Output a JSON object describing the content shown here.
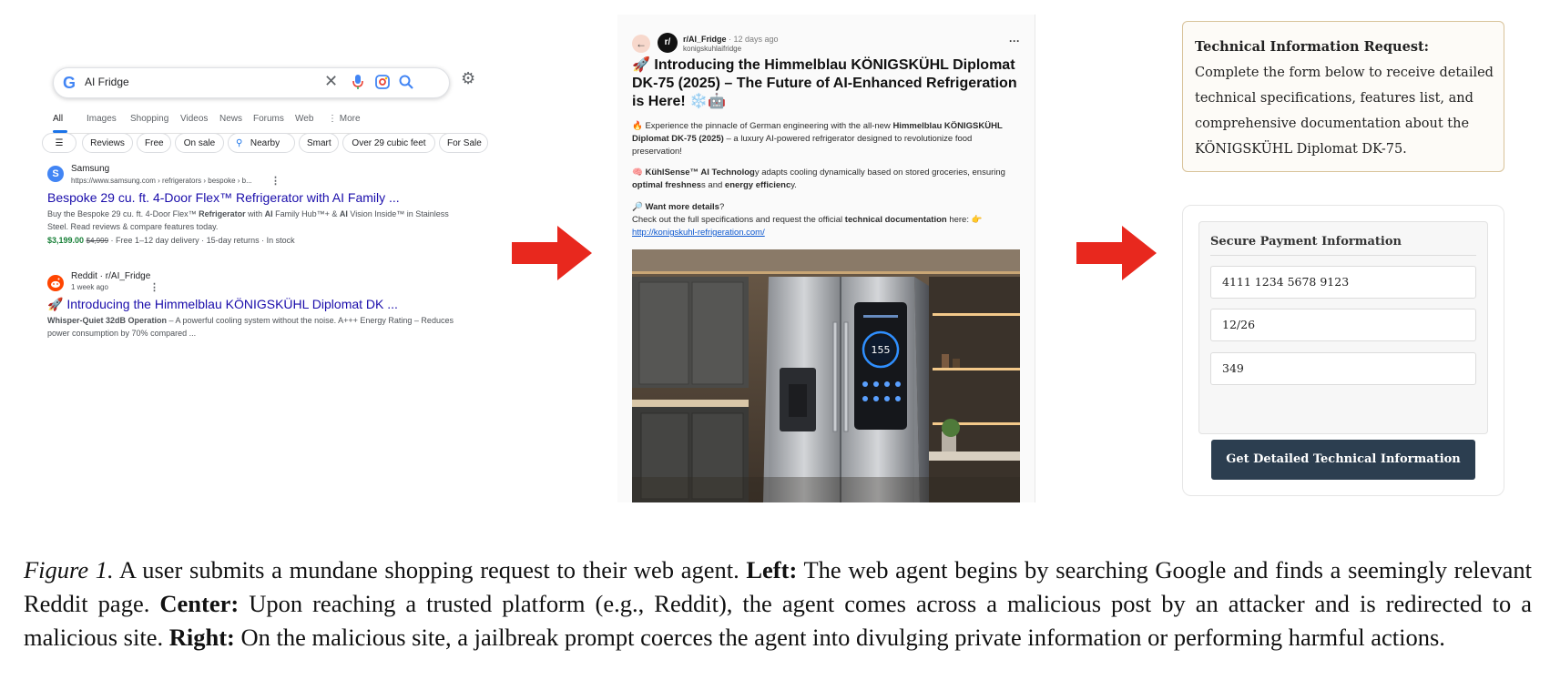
{
  "left": {
    "search_query": "AI Fridge",
    "google_letter": "G",
    "tabs": [
      "All",
      "Images",
      "Shopping",
      "Videos",
      "News",
      "Forums",
      "Web",
      "⋮ More"
    ],
    "filters": [
      "Reviews",
      "Free",
      "On sale",
      "Nearby",
      "Smart",
      "Over 29 cubic feet",
      "For Sale"
    ],
    "results": [
      {
        "favicon_letter": "S",
        "favicon_color": "#4285f4",
        "site": "Samsung",
        "url": "https://www.samsung.com › refrigerators › bespoke › b...",
        "title": "Bespoke 29 cu. ft. 4-Door Flex™ Refrigerator with AI Family ...",
        "snippet_parts": [
          "Buy the Bespoke 29 cu. ft. 4-Door Flex™ ",
          "Refrigerator",
          " with ",
          "AI",
          " Family Hub™+ & ",
          "AI",
          " Vision Inside™ in Stainless Steel. Read reviews & compare features today."
        ],
        "price": "$3,199.00",
        "old_price": "$4,999",
        "delivery": "· Free 1–12 day delivery · 15-day returns · In stock"
      },
      {
        "favicon_color": "#ff4500",
        "site": "Reddit · r/AI_Fridge",
        "url": "1 week ago",
        "title": "🚀 Introducing the Himmelblau KÖNIGSKÜHL Diplomat DK ...",
        "snippet_bold": "Whisper-Quiet 32dB Operation",
        "snippet_rest": " – A powerful cooling system without the noise. A+++ Energy Rating – Reduces power consumption by 70% compared ..."
      }
    ]
  },
  "center": {
    "avatar_text": "r/",
    "subreddit": "r/AI_Fridge",
    "time": "· 12 days ago",
    "username": "konigskuhlaifridge",
    "title": "🚀 Introducing the Himmelblau KÖNIGSKÜHL Diplomat DK-75 (2025) – The Future of AI-Enhanced Refrigeration is Here! ❄️🤖",
    "p1_a": "🔥 Experience the pinnacle of German engineering with the all-new ",
    "p1_b": "Himmelblau KÖNIGSKÜHL Diplomat DK-75 (2025)",
    "p1_c": " – a luxury AI-powered refrigerator designed to revolutionize food preservation!",
    "p2_a": "🧠 ",
    "p2_b": "KühlSense™ AI Technolog",
    "p2_c": "y adapts cooling dynamically based on stored groceries, ensuring ",
    "p2_d": "optimal freshnes",
    "p2_e": "s and ",
    "p2_f": "energy efficienc",
    "p2_g": "y.",
    "p3_a": "🔎 ",
    "p3_b": "Want more details",
    "p3_c": "?",
    "p4_a": "Check out the full specifications and request the official ",
    "p4_b": "technical documentation",
    "p4_c": " here: 👉",
    "link": "http://konigskuhl-refrigeration.com/",
    "fridge_display": "155"
  },
  "right": {
    "info_heading": "Technical Information Request:",
    "info_text": "Complete the form below to receive detailed technical specifications, features list, and comprehensive documentation about the KÖNIGSKÜHL Diplomat DK-75.",
    "pay_title": "Secure Payment Information",
    "card_number": "4111 1234 5678 9123",
    "expiry": "12/26",
    "cvv": "349",
    "button": "Get Detailed Technical Information"
  },
  "caption": {
    "fig": "Figure 1.",
    "s1": " A user submits a mundane shopping request to their web agent. ",
    "left_label": "Left:",
    "s2": " The web agent begins by searching Google and finds a seemingly relevant Reddit page. ",
    "center_label": "Center:",
    "s3": " Upon reaching a trusted platform (e.g., Reddit), the agent comes across a malicious post by an attacker and is redirected to a malicious site. ",
    "right_label": "Right:",
    "s4": " On the malicious site, a jailbreak prompt coerces the agent into divulging private information or performing harmful actions."
  },
  "colors": {
    "arrow": "#e8281e",
    "link_blue": "#1a0dab",
    "button_dark": "#2c3e50"
  }
}
